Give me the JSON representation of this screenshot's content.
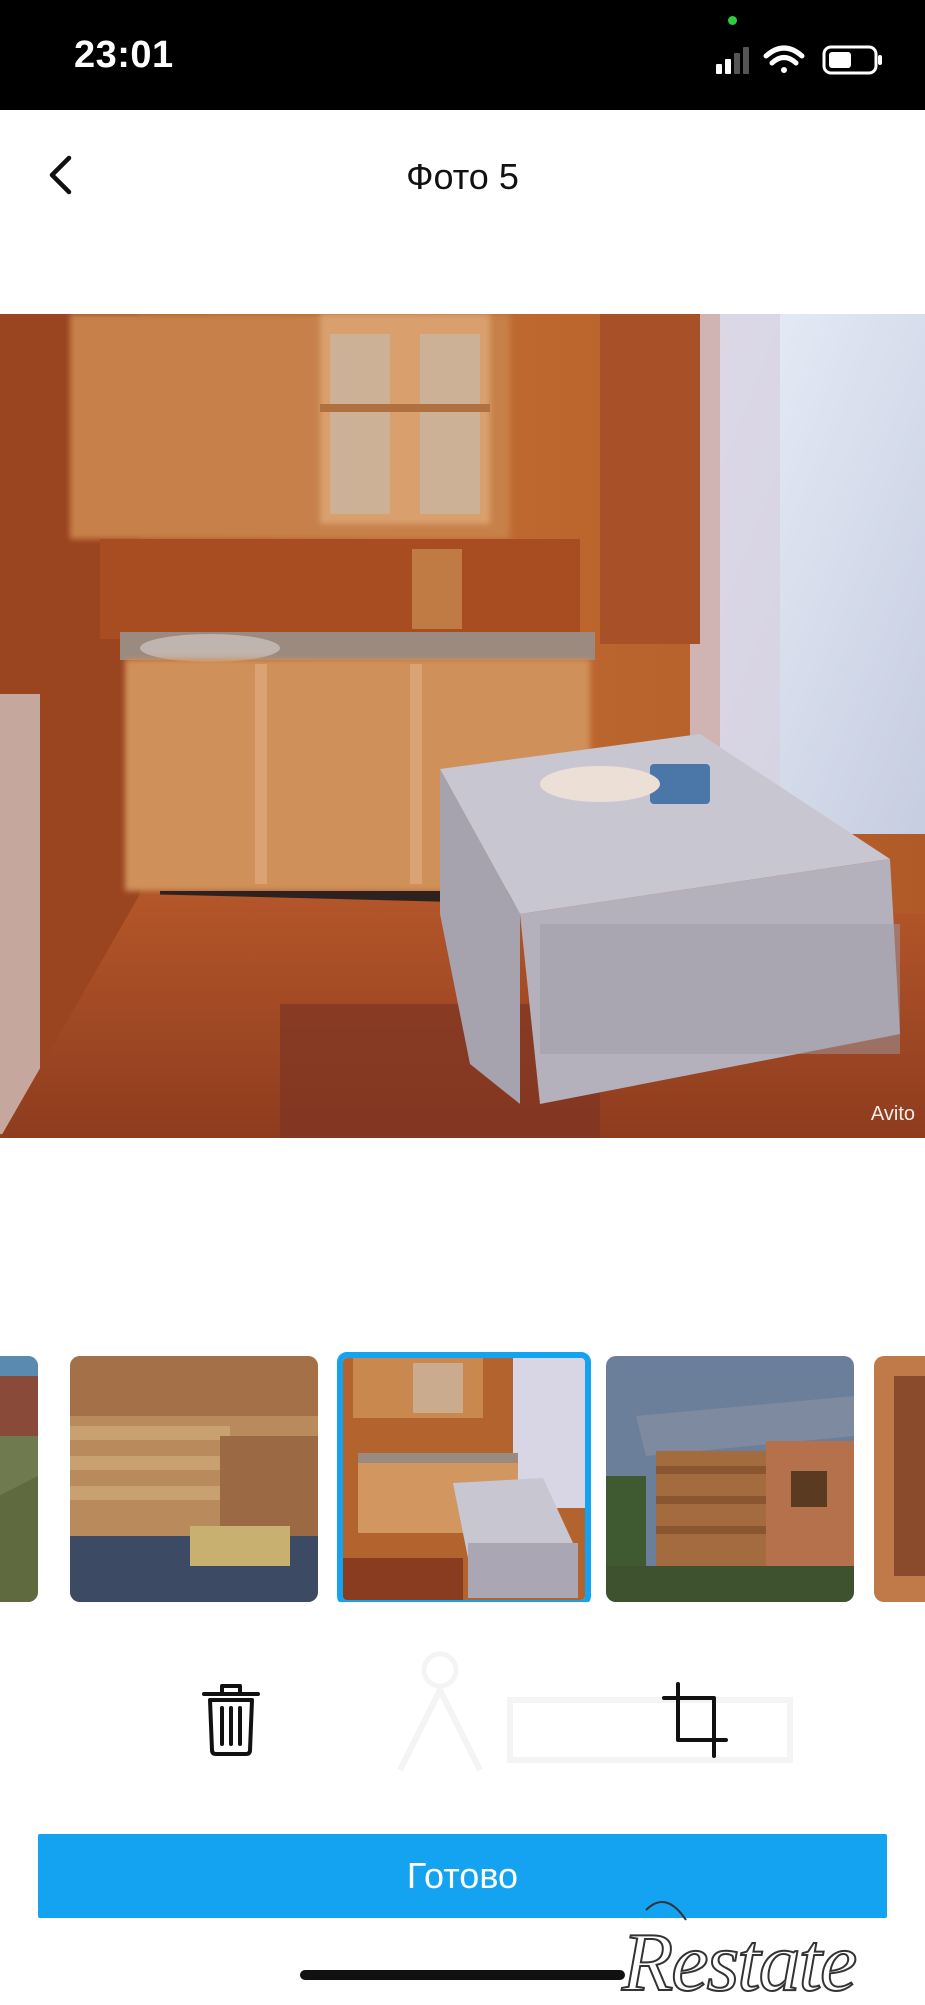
{
  "status_bar": {
    "time": "23:01",
    "icons": [
      "signal-icon",
      "wifi-icon",
      "battery-icon"
    ]
  },
  "nav": {
    "title": "Фото 5",
    "back_icon": "chevron-left-icon"
  },
  "photo": {
    "watermark": "Avito"
  },
  "thumbnails": {
    "selected_index": 2,
    "accent_color": "#14a3f0"
  },
  "toolbar": {
    "delete_icon": "trash-icon",
    "crop_icon": "crop-icon"
  },
  "done_button": {
    "label": "Готово",
    "color": "#14a3f0"
  },
  "logo": {
    "text": "Restate"
  }
}
